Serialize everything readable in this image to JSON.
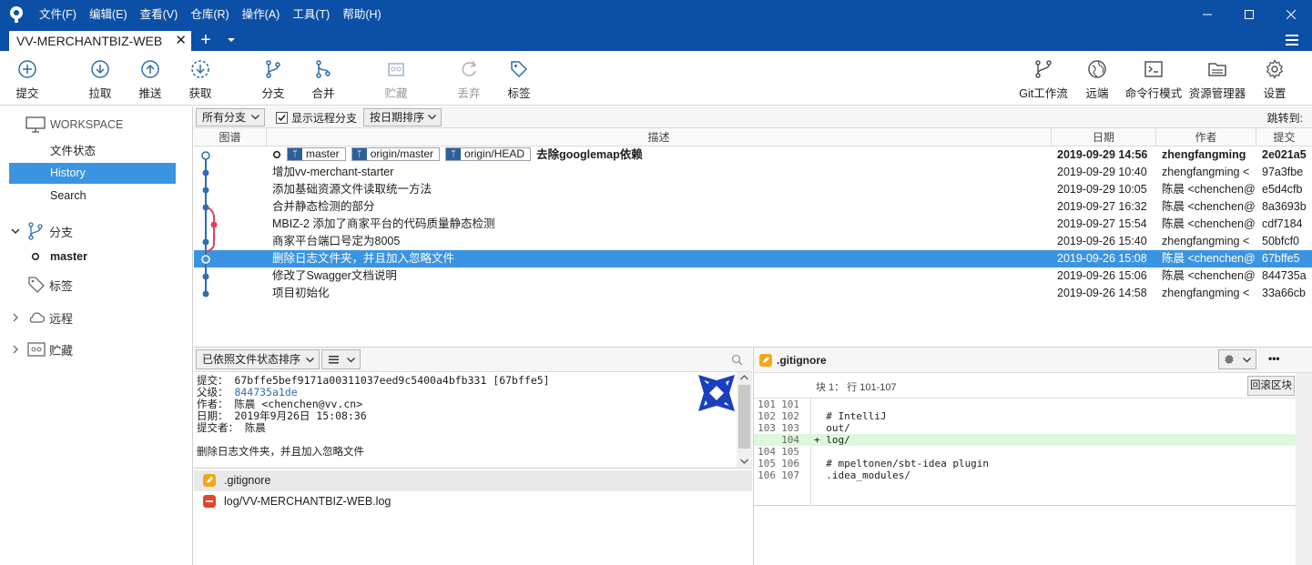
{
  "menu": [
    "文件(F)",
    "编辑(E)",
    "查看(V)",
    "仓库(R)",
    "操作(A)",
    "工具(T)",
    "帮助(H)"
  ],
  "repo_tab": {
    "title": "VV-MERCHANTBIZ-WEB",
    "close": "✕",
    "add": "+"
  },
  "toolbar": {
    "commit": "提交",
    "pull": "拉取",
    "push": "推送",
    "fetch": "获取",
    "branch": "分支",
    "merge": "合并",
    "stash": "贮藏",
    "discard": "丢弃",
    "tag": "标签",
    "gitflow": "Git工作流",
    "remote": "远端",
    "terminal": "命令行模式",
    "explorer": "资源管理器",
    "settings": "设置"
  },
  "sidebar": {
    "workspace": "WORKSPACE",
    "file_status": "文件状态",
    "history": "History",
    "search": "Search",
    "branches": "分支",
    "master": "master",
    "tags": "标签",
    "remotes": "远程",
    "stashes": "贮藏"
  },
  "filter": {
    "branches": "所有分支",
    "show_remote": "显示远程分支",
    "sort": "按日期排序",
    "jump": "跳转到:"
  },
  "columns": {
    "graph": "图谱",
    "desc": "描述",
    "date": "日期",
    "author": "作者",
    "commit": "提交"
  },
  "refs": [
    "master",
    "origin/master",
    "origin/HEAD"
  ],
  "commits": [
    {
      "desc": "去除googlemap依赖",
      "date": "2019-09-29 14:56",
      "author": "zhengfangming",
      "hash": "2e021a5"
    },
    {
      "desc": "增加vv-merchant-starter",
      "date": "2019-09-29 10:40",
      "author": "zhengfangming <",
      "hash": "97a3fbe"
    },
    {
      "desc": "添加基础资源文件读取统一方法",
      "date": "2019-09-29 10:05",
      "author": "陈晨 <chenchen@",
      "hash": "e5d4cfb"
    },
    {
      "desc": "合并静态检测的部分",
      "date": "2019-09-27 16:32",
      "author": "陈晨 <chenchen@",
      "hash": "8a3693b"
    },
    {
      "desc": "MBIZ-2 添加了商家平台的代码质量静态检测",
      "date": "2019-09-27 15:54",
      "author": "陈晨 <chenchen@",
      "hash": "cdf7184"
    },
    {
      "desc": "商家平台端口号定为8005",
      "date": "2019-09-26 15:40",
      "author": "zhengfangming <",
      "hash": "50bfcf0"
    },
    {
      "desc": "删除日志文件夹，并且加入忽略文件",
      "date": "2019-09-26 15:08",
      "author": "陈晨 <chenchen@",
      "hash": "67bffe5"
    },
    {
      "desc": "修改了Swagger文档说明",
      "date": "2019-09-26 15:06",
      "author": "陈晨 <chenchen@",
      "hash": "844735a"
    },
    {
      "desc": "项目初始化",
      "date": "2019-09-26 14:58",
      "author": "zhengfangming <",
      "hash": "33a66cb"
    }
  ],
  "file_sort": "已依照文件状态排序",
  "commit_info": {
    "commit": "提交： 67bffe5bef9171a00311037eed9c5400a4bfb331 [67bffe5]",
    "parent_label": "父级：",
    "parent": "844735a1de",
    "author": "作者： 陈晨 <chenchen@vv.cn>",
    "date": "日期： 2019年9月26日 15:08:36",
    "committer": "提交者： 陈晨",
    "message": "删除日志文件夹，并且加入忽略文件"
  },
  "files": [
    ".gitignore",
    "log/VV-MERCHANTBIZ-WEB.log"
  ],
  "diff": {
    "file": ".gitignore",
    "hunk": "块 1： 行 101-107",
    "revert": "回滚区块",
    "more": "•••",
    "lines": [
      {
        "old": "101",
        "new": "101",
        "text": "",
        "type": "ctx"
      },
      {
        "old": "102",
        "new": "102",
        "text": "  # IntelliJ",
        "type": "ctx"
      },
      {
        "old": "103",
        "new": "103",
        "text": "  out/",
        "type": "ctx"
      },
      {
        "old": "",
        "new": "104",
        "text": "+ log/",
        "type": "add"
      },
      {
        "old": "104",
        "new": "105",
        "text": "",
        "type": "ctx"
      },
      {
        "old": "105",
        "new": "106",
        "text": "  # mpeltonen/sbt-idea plugin",
        "type": "ctx"
      },
      {
        "old": "106",
        "new": "107",
        "text": "  .idea_modules/",
        "type": "ctx"
      }
    ]
  },
  "colors": {
    "accent": "#0c4fa6",
    "selection": "#3b94e1",
    "graph_blue": "#2f6cb0",
    "graph_red": "#e0405a",
    "added": "#dcf8dc"
  }
}
